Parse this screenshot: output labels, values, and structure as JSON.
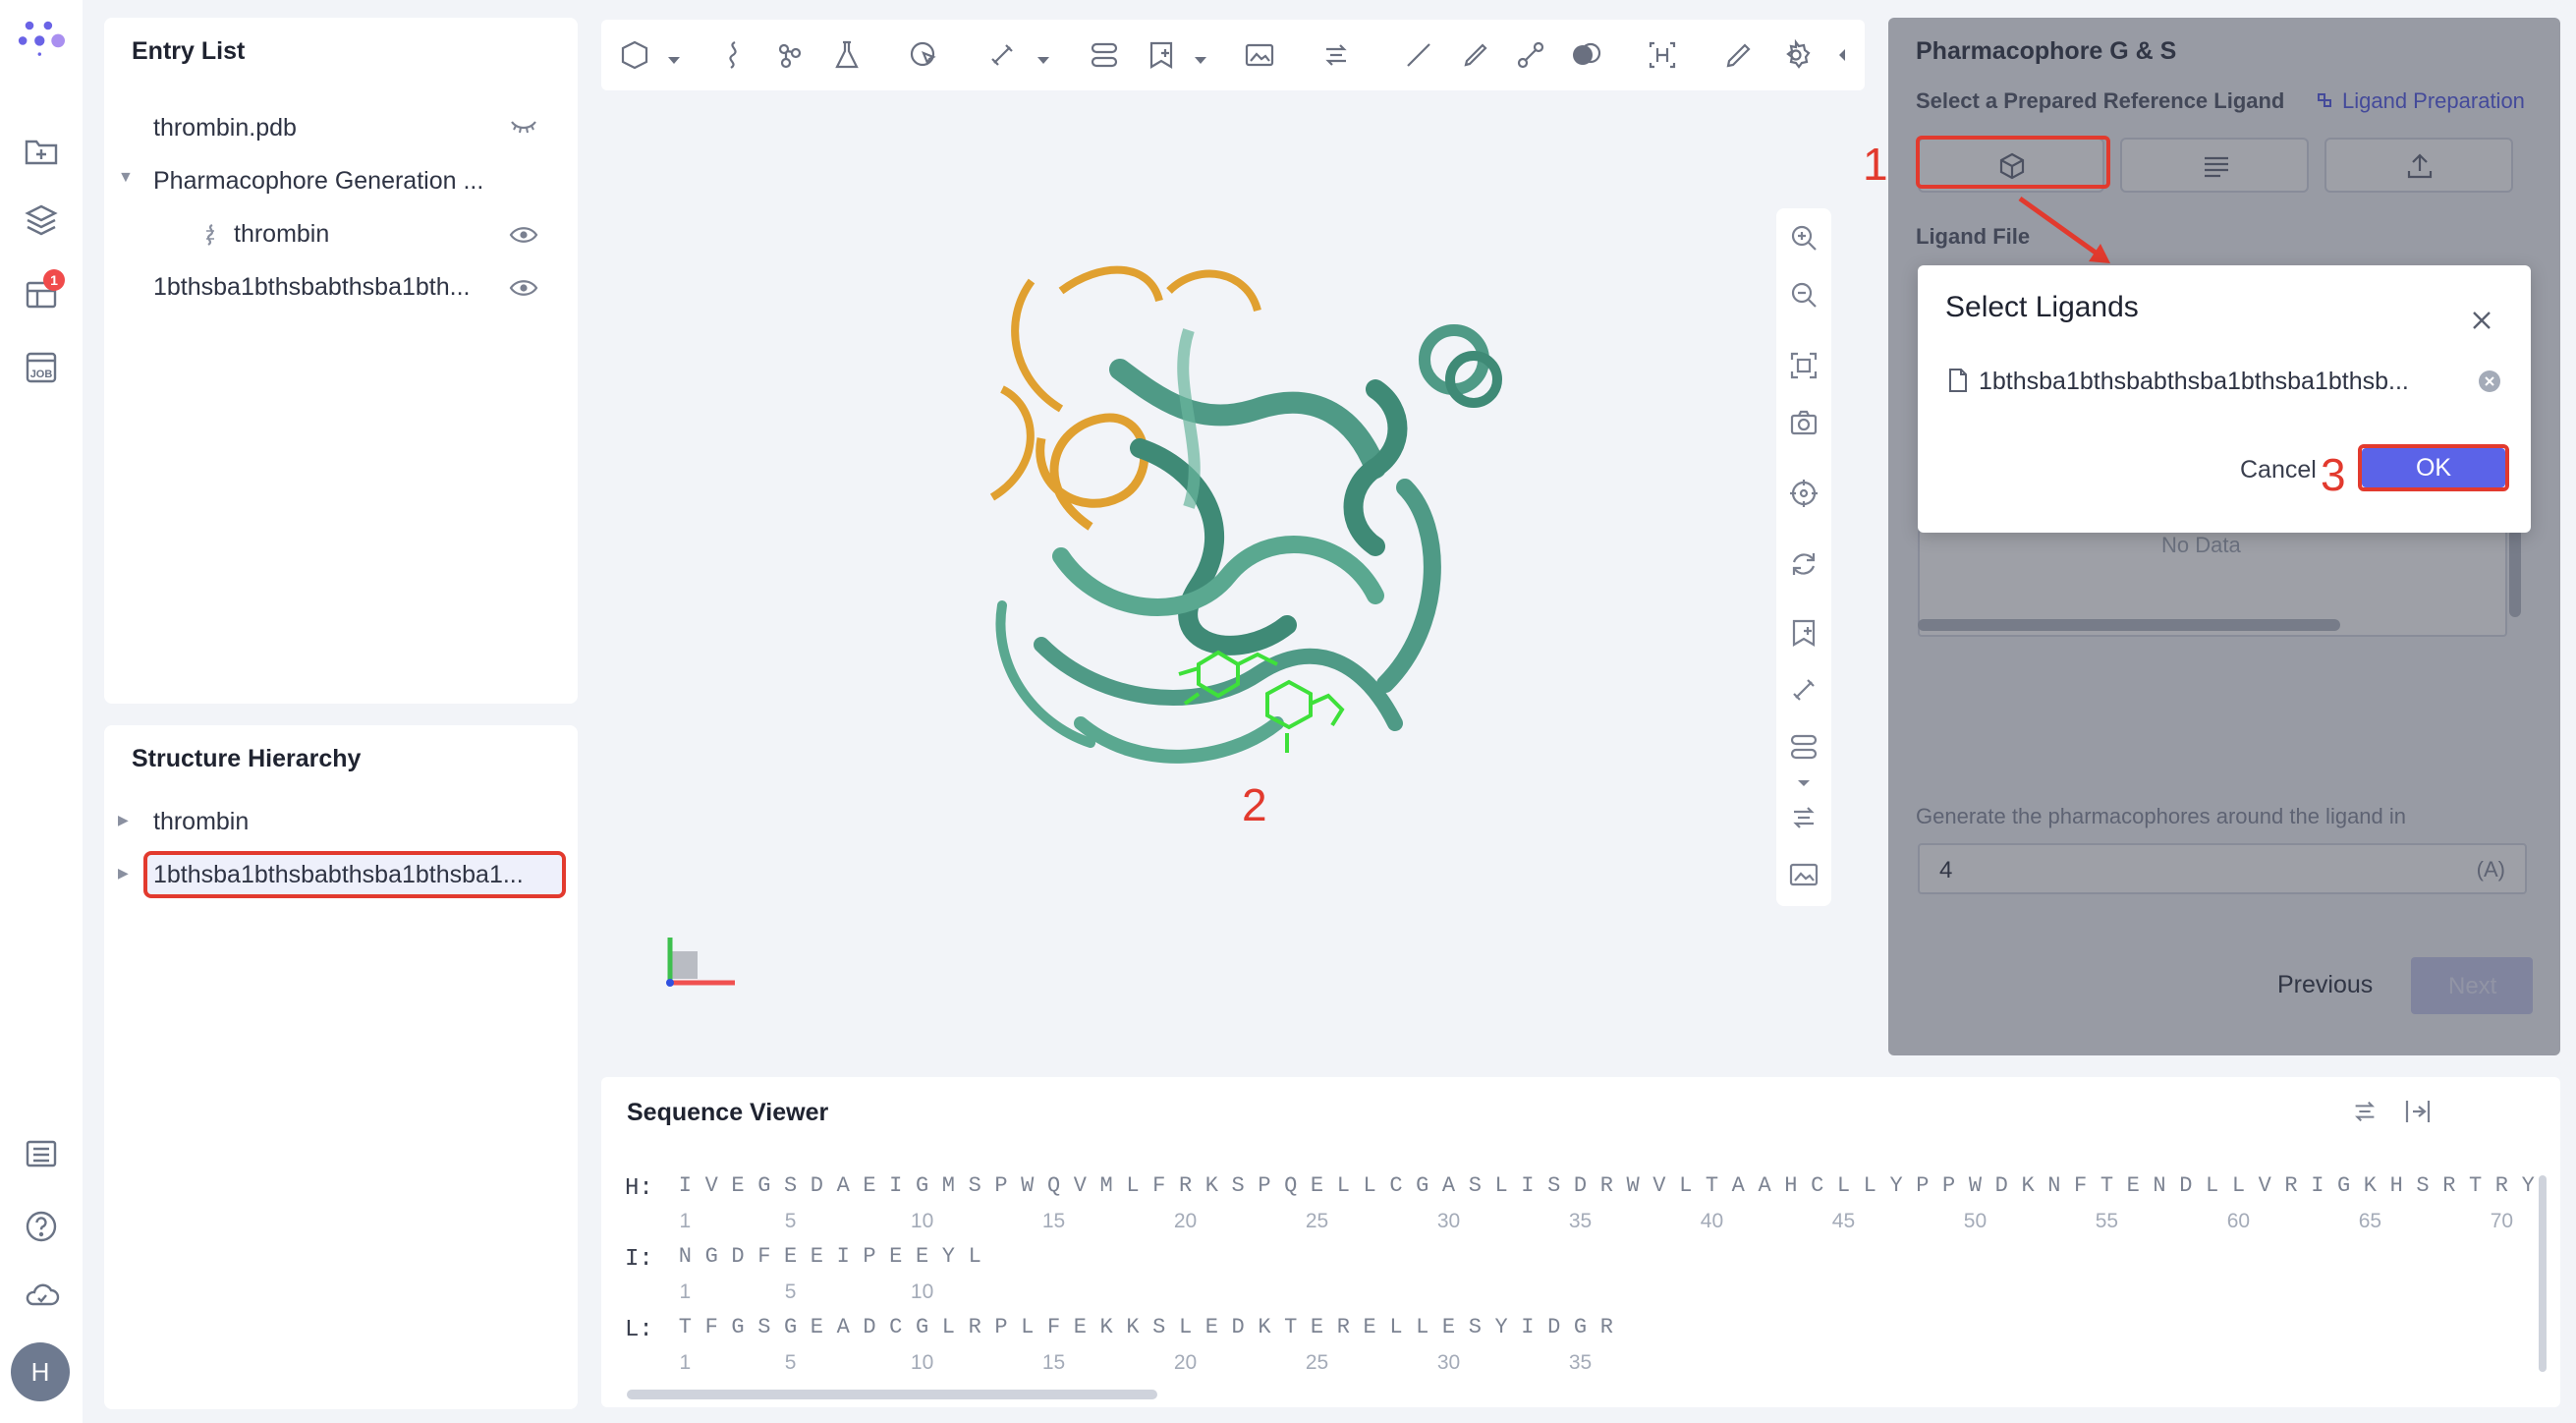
{
  "entry_list": {
    "title": "Entry List",
    "items": [
      {
        "label": "thrombin.pdb"
      },
      {
        "label": "Pharmacophore Generation ..."
      },
      {
        "label": "thrombin"
      },
      {
        "label": "1bthsba1bthsbabthsba1bth..."
      }
    ]
  },
  "rail": {
    "badge": "1",
    "avatar": "H"
  },
  "structure_hierarchy": {
    "title": "Structure Hierarchy",
    "items": [
      {
        "label": "thrombin"
      },
      {
        "label": "1bthsba1bthsbabthsba1bthsba1..."
      }
    ]
  },
  "right_panel": {
    "title": "Pharmacophore G & S",
    "select_label": "Select a Prepared Reference Ligand",
    "ligand_prep_link": "Ligand Preparation",
    "ligand_file_label": "Ligand File",
    "no_data": "No Data",
    "generate_label": "Generate the pharmacophores around the ligand in",
    "distance_value": "4",
    "distance_unit": "(A)",
    "previous_label": "Previous",
    "next_label": "Next"
  },
  "modal": {
    "title": "Select Ligands",
    "file_name": "1bthsba1bthsbabthsba1bthsba1bthsb...",
    "cancel_label": "Cancel",
    "ok_label": "OK"
  },
  "annotations": {
    "step1": "1",
    "step2": "2",
    "step3": "3"
  },
  "sequence_viewer": {
    "title": "Sequence Viewer",
    "chains": [
      {
        "name": "H:",
        "residues": "IVEGSDAEIGMSPWQVMLFRKSPQELLCGASLISDRWVLTAAHCLLYPPWDKNFTENDLLVRIGKHSRTRY"
      },
      {
        "name": "I:",
        "residues": "NGDFEEIPEEYL"
      },
      {
        "name": "L:",
        "residues": "TFGSGEADCGLRPLFEKKSLEDKTERELLESYIDGR"
      }
    ]
  },
  "colors": {
    "accent": "#5b63e8",
    "annotation_red": "#e23a2e",
    "protein": "#4f9a86",
    "loop": "#e0a030",
    "ligand": "#3ee03a"
  }
}
